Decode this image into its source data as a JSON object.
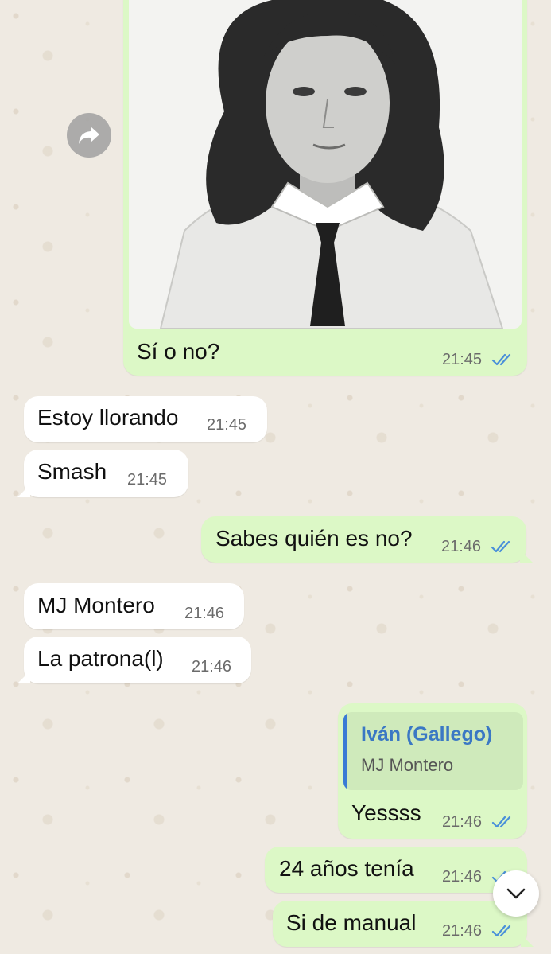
{
  "colors": {
    "outgoing_bubble": "#dcf8c6",
    "incoming_bubble": "#ffffff",
    "read_ticks": "#4a90d9",
    "quote_name": "#3b78c4",
    "wallpaper": "#efeae2"
  },
  "messages": [
    {
      "direction": "outgoing",
      "type": "image",
      "caption": "Sí o no?",
      "time": "21:45",
      "status_icon": "double-check-read-icon"
    },
    {
      "direction": "incoming",
      "text": "Estoy llorando",
      "time": "21:45"
    },
    {
      "direction": "incoming",
      "text": "Smash",
      "time": "21:45"
    },
    {
      "direction": "outgoing",
      "text": "Sabes quién es no?",
      "time": "21:46",
      "status_icon": "double-check-read-icon"
    },
    {
      "direction": "incoming",
      "text": "MJ Montero",
      "time": "21:46"
    },
    {
      "direction": "incoming",
      "text": "La patrona(l)",
      "time": "21:46"
    },
    {
      "direction": "outgoing",
      "quoted": {
        "author": "Iván (Gallego)",
        "text": "MJ Montero"
      },
      "text": "Yessss",
      "time": "21:46",
      "status_icon": "double-check-read-icon"
    },
    {
      "direction": "outgoing",
      "text": "24 años tenía",
      "time": "21:46",
      "status_icon": "double-check-read-icon"
    },
    {
      "direction": "outgoing",
      "text": "Si de manual",
      "time": "21:46",
      "status_icon": "double-check-read-icon"
    }
  ],
  "icons": {
    "forward": "forward-arrow-icon",
    "scroll_down": "chevron-down-icon"
  }
}
